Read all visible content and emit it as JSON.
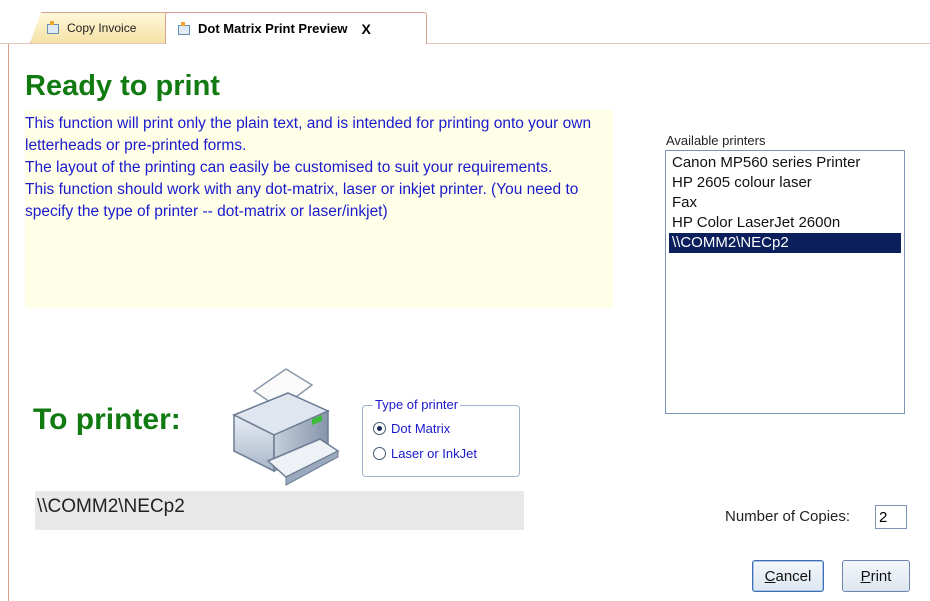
{
  "tabs": [
    {
      "label": "Copy Invoice",
      "active": false
    },
    {
      "label": "Dot Matrix Print Preview",
      "active": true,
      "close": "X"
    }
  ],
  "main": {
    "title": "Ready to print",
    "description": [
      "This function will print only the plain text, and is intended for printing onto your own letterheads or pre-printed forms.",
      "The layout of the printing can easily be customised to suit your requirements.",
      "This function should work with any dot-matrix, laser or inkjet printer. (You need to specify the type of printer -- dot-matrix or laser/inkjet)"
    ],
    "to_printer_label": "To printer:",
    "selected_printer": "\\\\COMM2\\NECp2"
  },
  "printer_type": {
    "legend": "Type of printer",
    "options": [
      {
        "label": "Dot Matrix",
        "checked": true
      },
      {
        "label": "Laser or InkJet",
        "checked": false
      }
    ]
  },
  "printers": {
    "label": "Available printers",
    "items": [
      {
        "label": "Canon MP560 series Printer",
        "selected": false
      },
      {
        "label": "HP 2605 colour laser",
        "selected": false
      },
      {
        "label": "Fax",
        "selected": false
      },
      {
        "label": "HP Color LaserJet 2600n",
        "selected": false
      },
      {
        "label": "\\\\COMM2\\NECp2",
        "selected": true
      }
    ]
  },
  "copies": {
    "label": "Number of Copies:",
    "value": "2"
  },
  "buttons": {
    "cancel": {
      "accel": "C",
      "rest": "ancel"
    },
    "print": {
      "accel": "P",
      "rest": "rint"
    }
  },
  "colors": {
    "title_green": "#117a11",
    "desc_blue": "#1a1acc",
    "selection": "#0a1f5c",
    "desc_bg": "#ffffe8"
  }
}
